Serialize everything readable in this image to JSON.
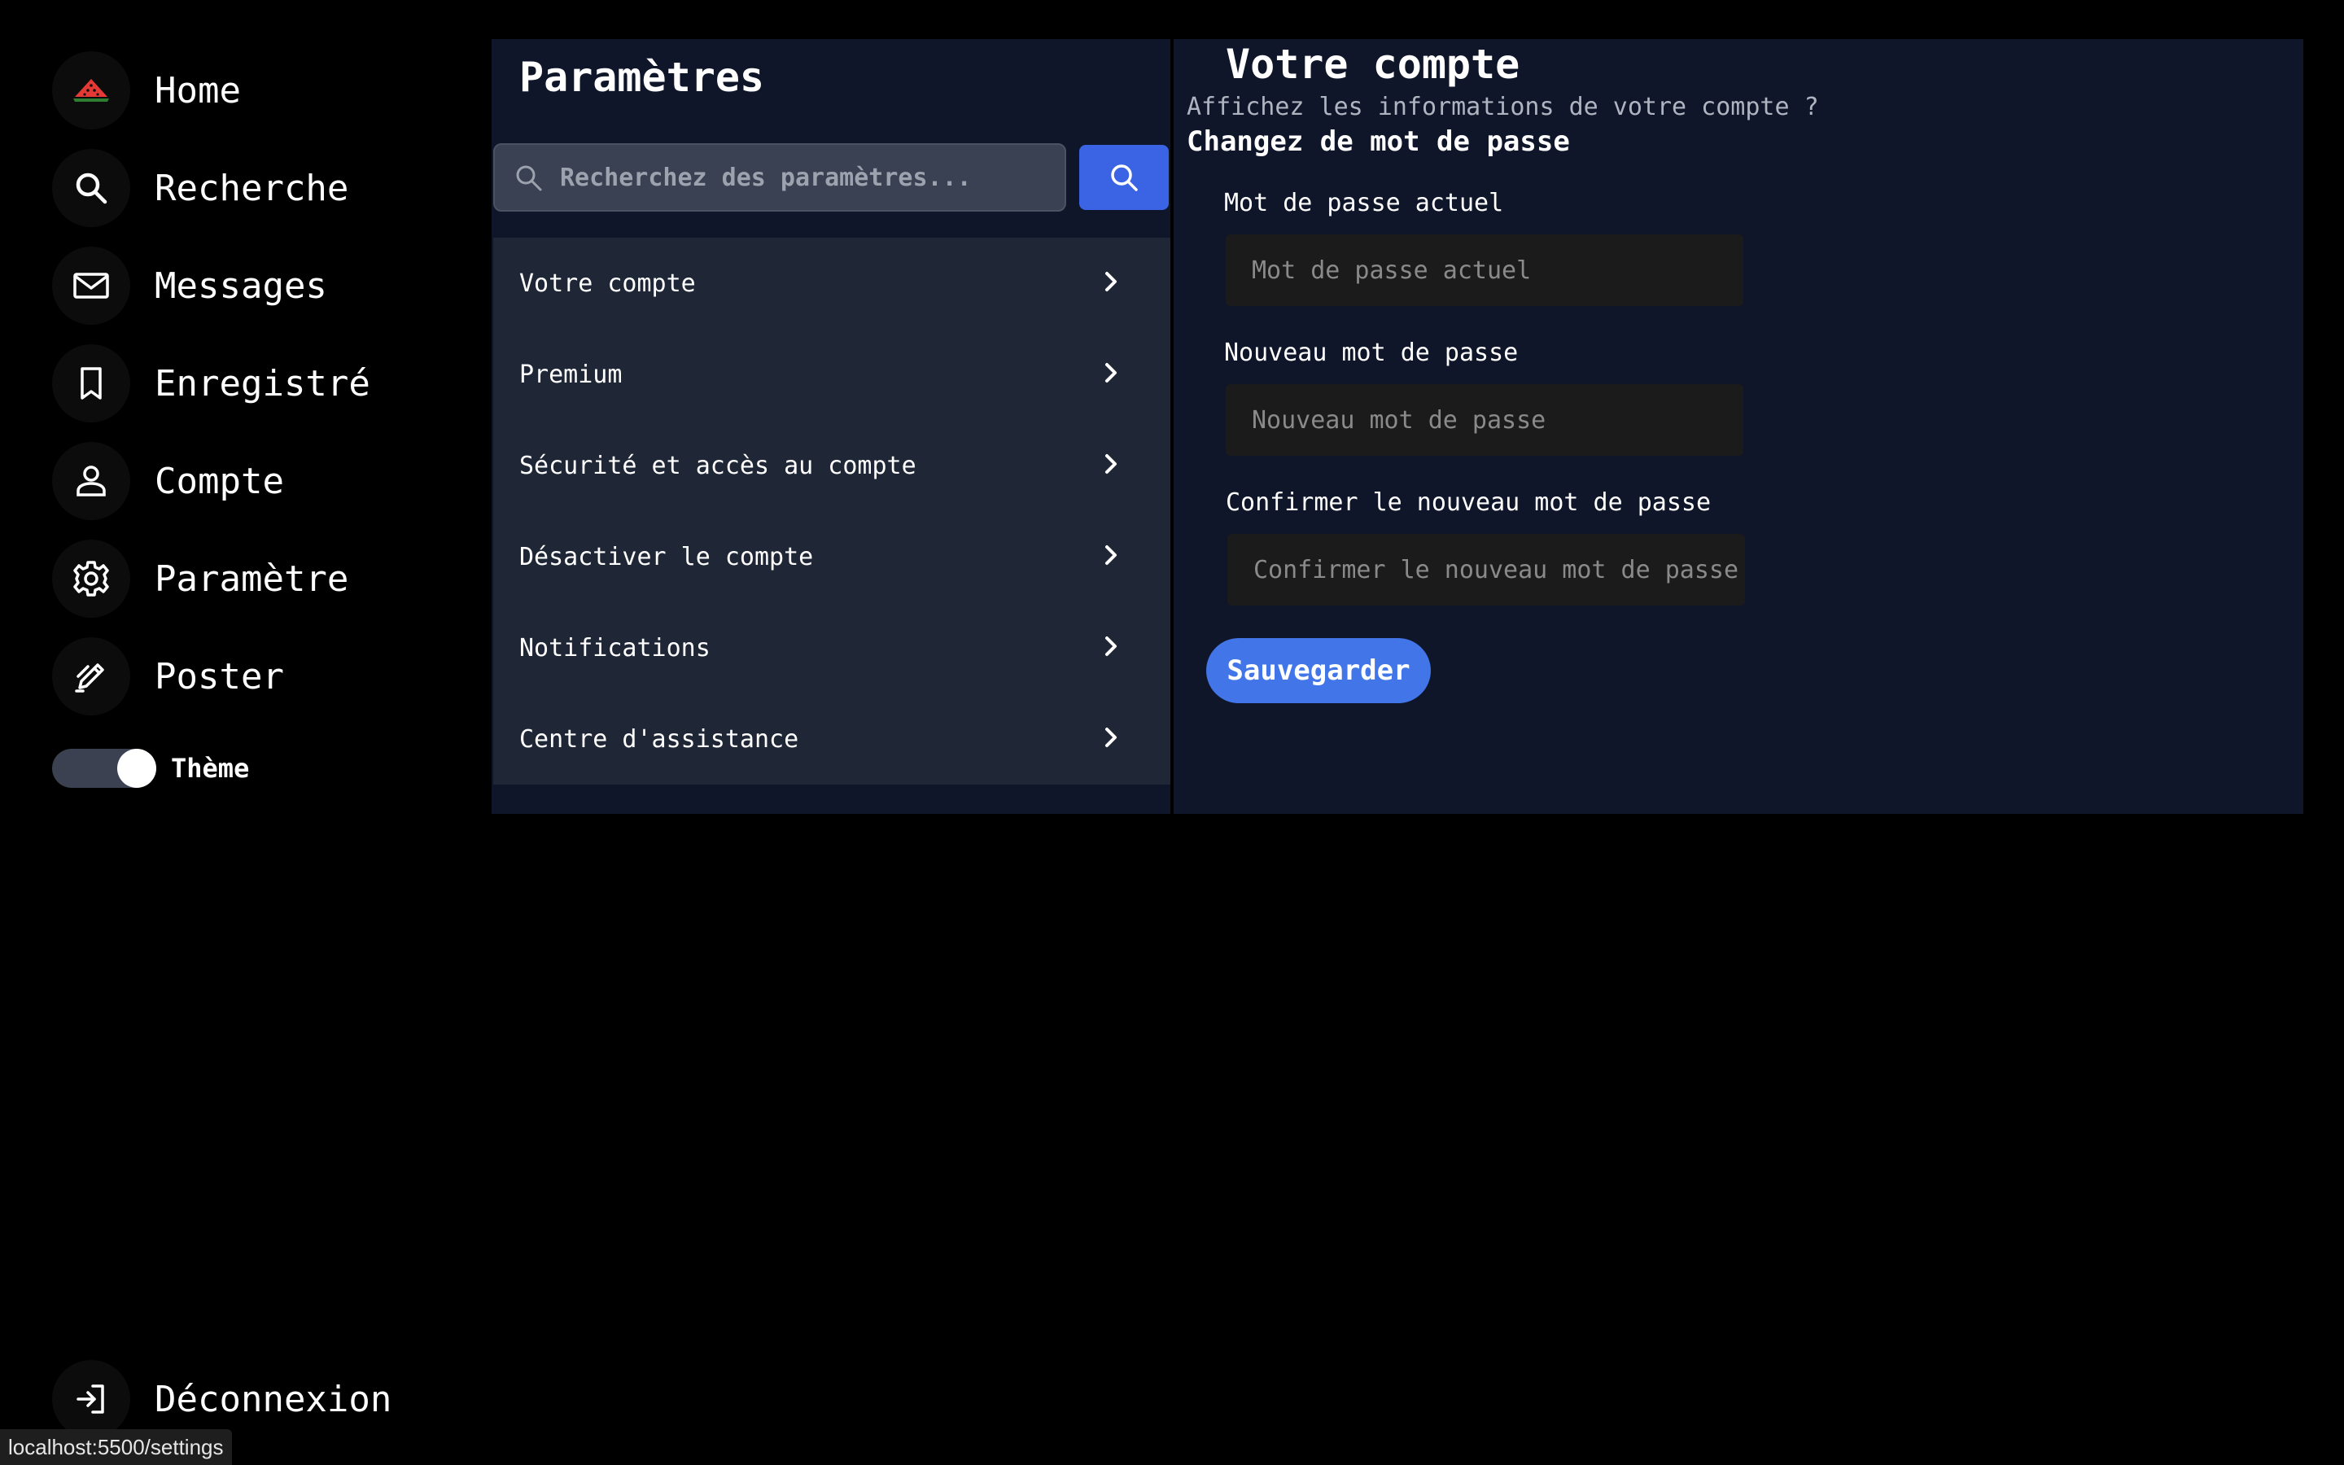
{
  "nav": {
    "items": [
      {
        "label": "Home",
        "icon": "watermelon-icon"
      },
      {
        "label": "Recherche",
        "icon": "search-icon"
      },
      {
        "label": "Messages",
        "icon": "mail-icon"
      },
      {
        "label": "Enregistré",
        "icon": "bookmark-icon"
      },
      {
        "label": "Compte",
        "icon": "user-icon"
      },
      {
        "label": "Paramètre",
        "icon": "gear-icon"
      },
      {
        "label": "Poster",
        "icon": "pen-icon"
      }
    ],
    "theme_label": "Thème",
    "logout_label": "Déconnexion"
  },
  "settings": {
    "title": "Paramètres",
    "search_placeholder": "Recherchez des paramètres...",
    "menu": [
      {
        "label": "Votre compte"
      },
      {
        "label": "Premium"
      },
      {
        "label": "Sécurité et accès au compte"
      },
      {
        "label": "Désactiver le compte"
      },
      {
        "label": "Notifications"
      },
      {
        "label": "Centre d'assistance"
      }
    ]
  },
  "account": {
    "title": "Votre compte",
    "subtitle": "Affichez les informations de votre compte ?",
    "section_title": "Changez de mot de passe",
    "fields": [
      {
        "label": "Mot de passe actuel",
        "placeholder": "Mot de passe actuel"
      },
      {
        "label": "Nouveau mot de passe",
        "placeholder": "Nouveau mot de passe"
      },
      {
        "label": "Confirmer le nouveau mot de passe",
        "placeholder": "Confirmer le nouveau mot de passe"
      }
    ],
    "save_label": "Sauvegarder"
  },
  "status": {
    "url": "localhost:5500/settings"
  },
  "colors": {
    "accent": "#3b64e4",
    "save_button": "#4276e8",
    "panel_bg": "#0f1629",
    "menu_bg": "#1f2737",
    "watermelon_red": "#e53935",
    "watermelon_green": "#2e7d32"
  }
}
